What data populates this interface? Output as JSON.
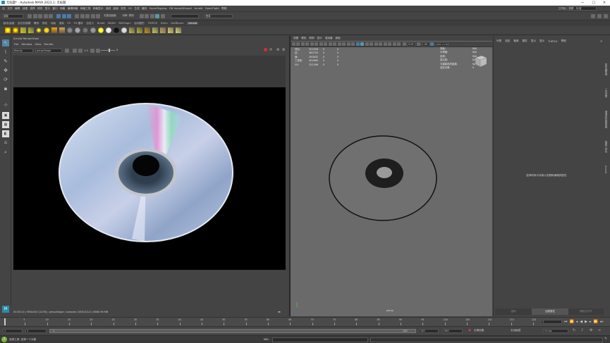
{
  "window": {
    "title": "无标题* - Autodesk MAYA 2023.1: 无标题",
    "minimize": "—",
    "maximize": "□",
    "close": "✕"
  },
  "menubar": {
    "items": [
      "文件",
      "编辑",
      "创建",
      "选择",
      "修改",
      "显示",
      "窗口",
      "网格",
      "编辑网格",
      "网格工具",
      "网格显示",
      "曲线",
      "曲面",
      "变形",
      "UV",
      "生成",
      "缓存",
      "SuperRigging",
      "GN Import/Export",
      "Arnold",
      "OpenFlight",
      "帮助"
    ],
    "workspace_label": "工作区:",
    "workspace_value": "建模 - 标准"
  },
  "status_line": {
    "mode": "建模",
    "symmetry": "对称: 禁用",
    "no_live": "无激活曲面",
    "login": "登录"
  },
  "shelf": {
    "tabs": [
      "曲线/曲面",
      "多边形建模",
      "雕刻",
      "绑定",
      "动画",
      "渲染",
      "FX",
      "FX 缓存",
      "自定义",
      "Bullet",
      "MASH",
      "MGPlugin",
      "运动图形",
      "TURTLE",
      "XGen",
      "GoZBrush",
      "Arnold"
    ],
    "active_tab": "Arnold"
  },
  "render_view": {
    "title": "Arnold RenderView",
    "menu": [
      "File",
      "Window",
      "View",
      "Render"
    ],
    "aov": "Beauty",
    "camera": "perspShape",
    "zoom": "1:1",
    "exposure": "0",
    "status": "00:00:14 | 960x540 (1476) | perspShape | samples 3/5/5/2/2/2 | 8660.96 MB",
    "disc_colors": {
      "base": "#c8d6ea",
      "hub": "#4a5e72",
      "hole": "#050505"
    }
  },
  "viewport": {
    "menu": [
      "视图",
      "着色",
      "照明",
      "显示",
      "渲染器",
      "面板"
    ],
    "near_value": "0.00",
    "far_value": "1.00",
    "color_space": "ACES 1.0 SDR-video (sRGB)",
    "hud": {
      "rows": [
        {
          "label": "顶点:",
          "a": "321928",
          "b": "0",
          "c": "0"
        },
        {
          "label": "边:",
          "a": "483700",
          "b": "0",
          "c": "0"
        },
        {
          "label": "面:",
          "a": "200832",
          "b": "0",
          "c": "0"
        },
        {
          "label": "三角形:",
          "a": "401664",
          "b": "0",
          "c": "0"
        },
        {
          "label": "UV:",
          "a": "222166",
          "b": "0",
          "c": "0"
        }
      ],
      "right_rows": [
        {
          "label": "背面:",
          "value": "N/A"
        },
        {
          "label": "平滑度:",
          "value": "N/A"
        },
        {
          "label": "实例:",
          "value": "N/A"
        },
        {
          "label": "显示层:",
          "value": "N/A"
        },
        {
          "label": "与摄影机的距离:",
          "value": "N/A"
        },
        {
          "label": "选定对象:",
          "value": "0"
        }
      ]
    },
    "camera_label": "persp"
  },
  "attribute_editor": {
    "tabs": [
      "列表",
      "选定",
      "聚焦",
      "属性",
      "显示",
      "显示",
      "TURTLE",
      "帮助"
    ],
    "empty_message": "选择球体中对象以查看和编辑其属性",
    "bottom_tabs": [
      "选择",
      "加载属性",
      "删除文件节"
    ],
    "side_tabs": [
      "属性编辑器",
      "工具设置",
      "通道盒/层编辑器",
      "建模工具包",
      "Arnold"
    ]
  },
  "time_slider": {
    "ticks": [
      "5",
      "10",
      "15",
      "20",
      "25",
      "30",
      "35",
      "40",
      "45",
      "50",
      "55",
      "60",
      "65",
      "70",
      "75",
      "80",
      "85",
      "90",
      "95",
      "100",
      "105",
      "110",
      "115",
      "120"
    ],
    "current_frame": "1"
  },
  "range_slider": {
    "start": "1",
    "playback_start": "1",
    "range_start_label": "1",
    "range_end_label": "120",
    "playback_end": "120",
    "anim_end": "200",
    "end": "200",
    "char_set": "无角色集",
    "anim_layer": "无动画层",
    "fps": "24 fps"
  },
  "command_line": {
    "lang": "MEL",
    "help": "选择工具: 选择一个对象"
  }
}
